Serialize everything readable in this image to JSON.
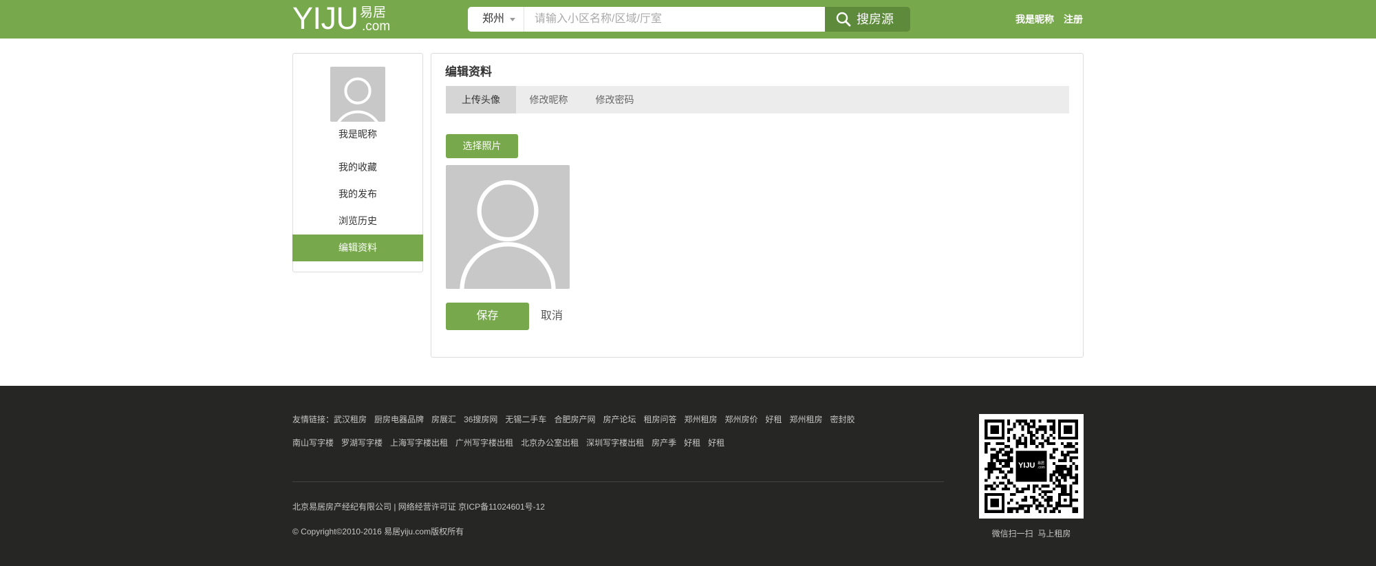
{
  "header": {
    "logo": {
      "main": "YIJU",
      "cn": "易居",
      "domain": ".com"
    },
    "search": {
      "city": "郑州",
      "placeholder": "请输入小区名称/区域/厅室",
      "button_label": "搜房源"
    },
    "user_links": {
      "nickname": "我是昵称",
      "register": "注册"
    }
  },
  "sidebar": {
    "nickname": "我是昵称",
    "items": [
      {
        "label": "我的收藏"
      },
      {
        "label": "我的发布"
      },
      {
        "label": "浏览历史"
      },
      {
        "label": "编辑资料",
        "active": true
      }
    ]
  },
  "panel": {
    "title": "编辑资料",
    "tabs": [
      {
        "label": "上传头像",
        "active": true
      },
      {
        "label": "修改昵称"
      },
      {
        "label": "修改密码"
      }
    ],
    "choose_photo_label": "选择照片",
    "save_label": "保存",
    "cancel_label": "取消"
  },
  "footer": {
    "friend_links_label": "友情链接：",
    "links_row1": [
      "武汉租房",
      "厨房电器品牌",
      "房展汇",
      "36搜房网",
      "无锡二手车",
      "合肥房产网",
      "房产论坛",
      "租房问答",
      "郑州租房",
      "郑州房价",
      "好租",
      "郑州租房",
      "密封胶"
    ],
    "links_row2": [
      "南山写字楼",
      "罗湖写字楼",
      "上海写字楼出租",
      "广州写字楼出租",
      "北京办公室出租",
      "深圳写字楼出租",
      "房产季",
      "好租",
      "好租"
    ],
    "company_line": "北京易居房产经纪有限公司 | 网络经营许可证 京ICP备11024601号-12",
    "copyright": "© Copyright©2010-2016 易居yiju.com版权所有",
    "qr_logo": {
      "main": "YIJU",
      "cn": "易居",
      "domain": ".com"
    },
    "qr_caption": "微信扫一扫  马上租房"
  },
  "icons": {
    "city_dropdown": "caret-down-icon",
    "search": "search-icon",
    "avatar": "user-silhouette-icon",
    "qr": "qr-code-icon"
  },
  "colors": {
    "brand_green": "#77a84b",
    "search_button": "#5d8a3b",
    "footer_background": "#262724",
    "avatar_placeholder": "#c8c8c8"
  }
}
